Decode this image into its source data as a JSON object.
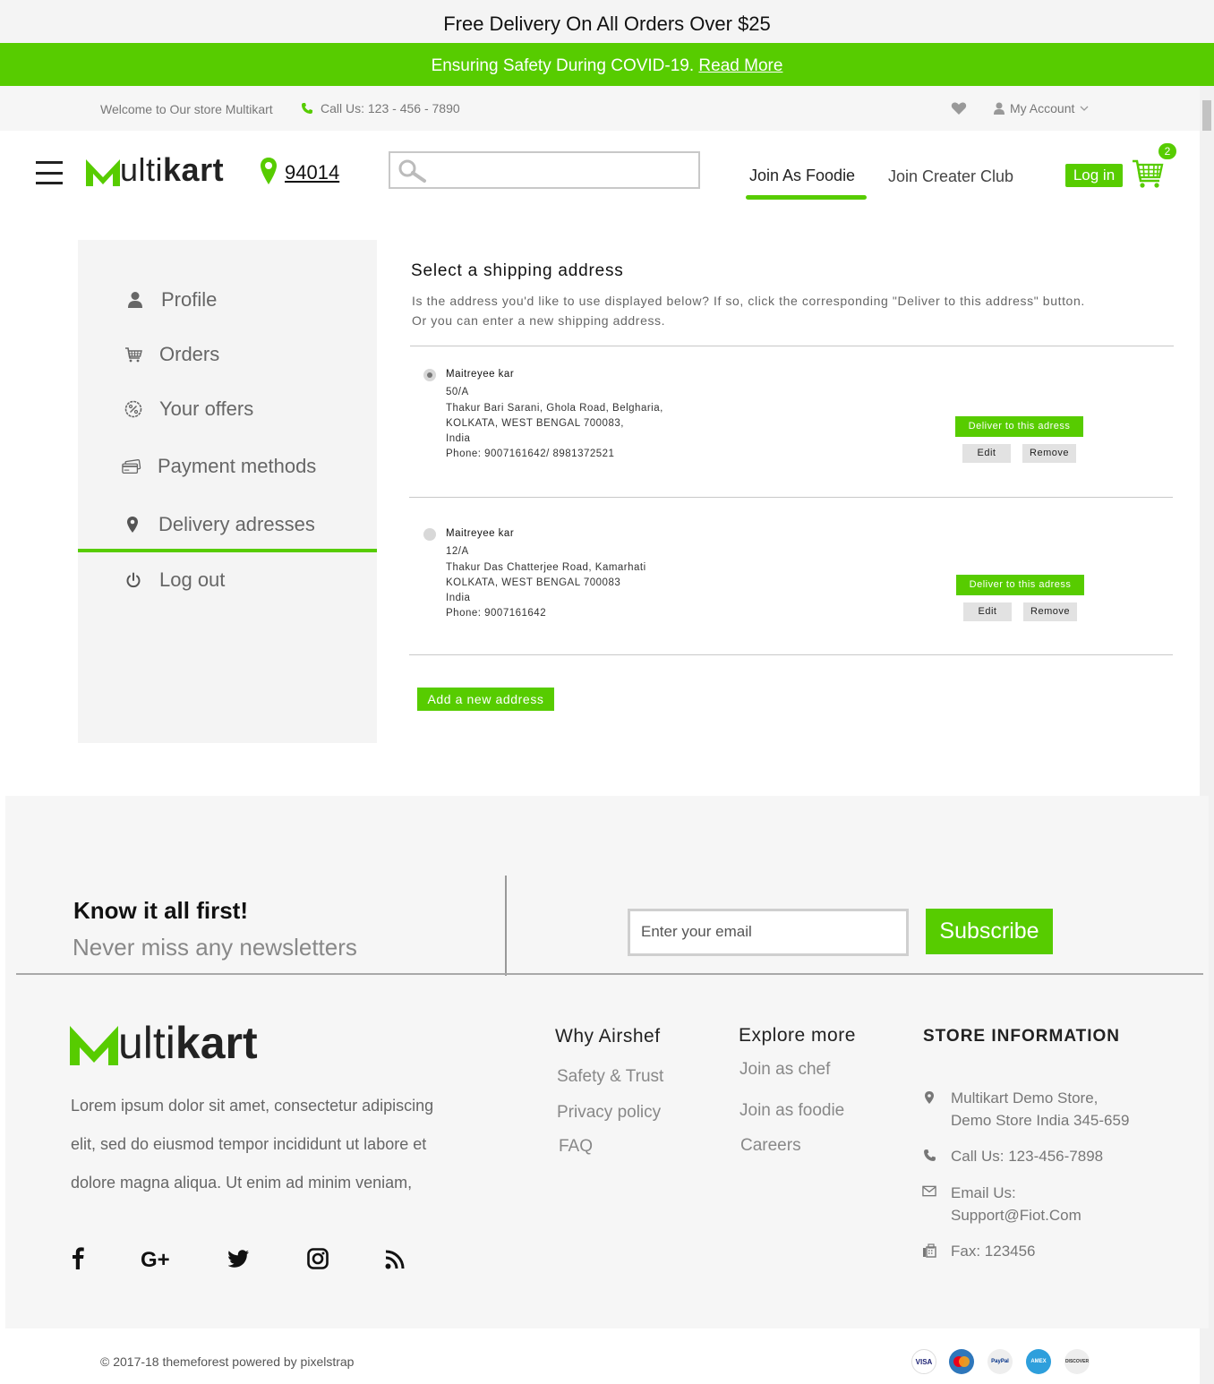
{
  "promo": {
    "delivery": "Free Delivery On All Orders Over $25",
    "covid": "Ensuring Safety During COVID-19.",
    "read_more": "Read More"
  },
  "topbar": {
    "welcome": "Welcome to Our store Multikart",
    "call": "Call Us: 123 - 456 - 7890",
    "account": "My Account"
  },
  "header": {
    "logo_first": "M",
    "logo_mid": "ulti",
    "logo_bold": "kart",
    "zipcode": "94014",
    "search_placeholder": "",
    "nav_foodie": "Join As Foodie",
    "nav_creater": "Join Creater Club",
    "login": "Log in",
    "cart_count": "2"
  },
  "sidebar": {
    "items": [
      {
        "label": "Profile",
        "icon": "user-icon"
      },
      {
        "label": "Orders",
        "icon": "cart-icon"
      },
      {
        "label": "Your offers",
        "icon": "offer-icon"
      },
      {
        "label": "Payment methods",
        "icon": "card-icon"
      },
      {
        "label": "Delivery adresses",
        "icon": "location-icon"
      },
      {
        "label": "Log out",
        "icon": "power-icon"
      }
    ],
    "active": "Delivery adresses"
  },
  "main": {
    "title": "Select a shipping address",
    "desc_line1": "Is the address you'd like to use displayed below? If so, click the corresponding \"Deliver to this address\" button.",
    "desc_line2": "Or you can enter a new shipping address.",
    "addresses": [
      {
        "name": "Maitreyee kar",
        "line1": "50/A",
        "line2": "Thakur Bari Sarani, Ghola Road, Belgharia,",
        "line3": "KOLKATA, WEST BENGAL 700083,",
        "line4": "India",
        "phone": "Phone: 9007161642/ 8981372521",
        "selected": true
      },
      {
        "name": "Maitreyee kar",
        "line1": "12/A",
        "line2": "Thakur Das Chatterjee Road, Kamarhati",
        "line3": "KOLKATA, WEST BENGAL 700083",
        "line4": "India",
        "phone": "Phone: 9007161642",
        "selected": false
      }
    ],
    "deliver_label": "Deliver to this adress",
    "edit_label": "Edit",
    "remove_label": "Remove",
    "add_label": "Add a new address"
  },
  "newsletter": {
    "title": "Know it all first!",
    "subtitle": "Never miss any newsletters",
    "email_placeholder": "Enter your email",
    "subscribe": "Subscribe"
  },
  "footer": {
    "desc_line1": "Lorem ipsum dolor sit amet, consectetur adipiscing",
    "desc_line2": "elit, sed do eiusmod tempor incididunt ut labore et",
    "desc_line3": "dolore magna aliqua. Ut enim ad minim veniam,",
    "social": [
      "facebook-icon",
      "google-plus-icon",
      "twitter-icon",
      "instagram-icon",
      "rss-icon"
    ],
    "col1_title": "Why Airshef",
    "col1_links": [
      "Safety & Trust",
      "Privacy policy",
      "FAQ"
    ],
    "col2_title": "Explore more",
    "col2_links": [
      "Join as chef",
      "Join as foodie",
      "Careers"
    ],
    "store_title": "STORE INFORMATION",
    "store_address_1": "Multikart Demo Store,",
    "store_address_2": "Demo Store India 345-659",
    "store_call": "Call Us: 123-456-7898",
    "store_email_1": "Email Us:",
    "store_email_2": "Support@Fiot.Com",
    "store_fax": "Fax: 123456",
    "copyright": "© 2017-18 themeforest powered by pixelstrap",
    "payments": [
      {
        "label": "VISA",
        "color": "#1a1f71"
      },
      {
        "label": "MasterCard",
        "color": "#eb001b"
      },
      {
        "label": "PayPal",
        "color": "#003087"
      },
      {
        "label": "AMEX",
        "color": "#2e77bb"
      },
      {
        "label": "DISCOVER",
        "color": "#f68121"
      }
    ]
  },
  "colors": {
    "accent": "#57cc00",
    "sidebar_bg": "#f4f4f4",
    "footer_bg": "#f6f6f6"
  }
}
